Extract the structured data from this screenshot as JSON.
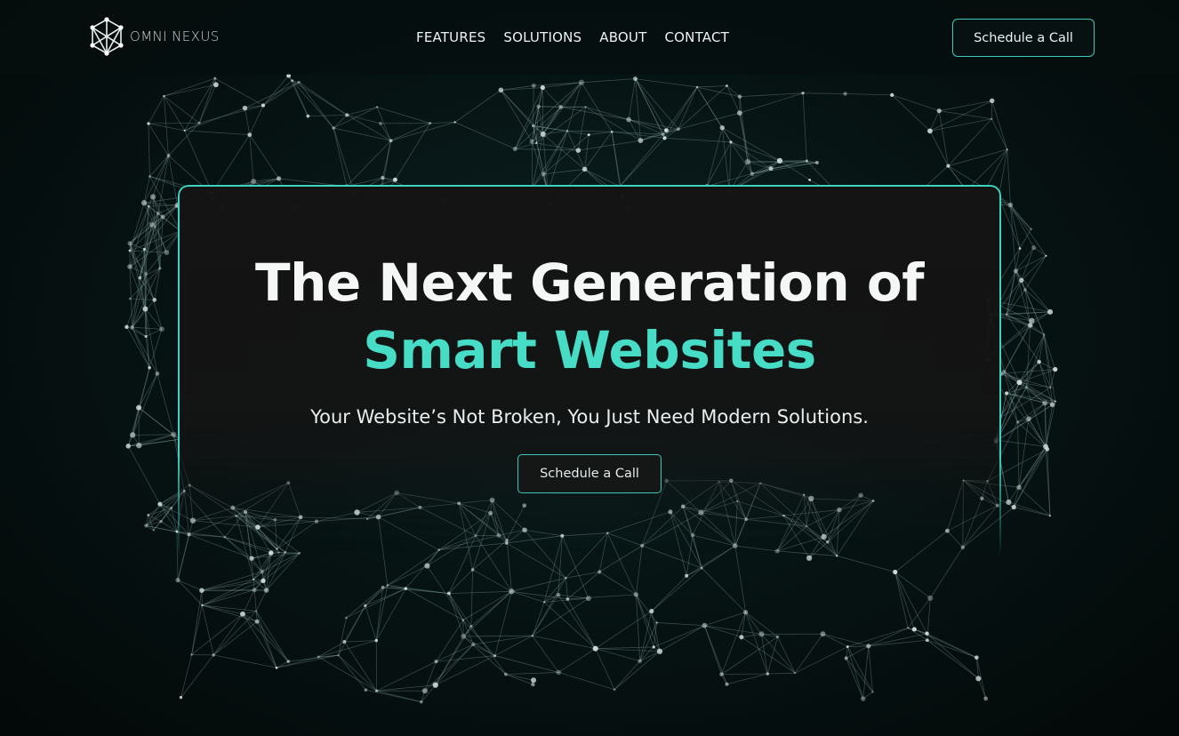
{
  "brand": {
    "logo_icon": "hexagon-network-icon",
    "name": "OMNI NEXUS"
  },
  "nav": {
    "links": [
      "FEATURES",
      "SOLUTIONS",
      "ABOUT",
      "CONTACT"
    ],
    "cta_label": "Schedule a Call"
  },
  "hero": {
    "title_line1": "The Next Generation of",
    "title_line2": "Smart Websites",
    "subtitle": "Your Website’s Not Broken, You Just Need Modern Solutions.",
    "cta_label": "Schedule a Call"
  },
  "colors": {
    "accent": "#46dcc6",
    "border": "#3dd3c0",
    "background": "#061010",
    "card": "#141414"
  }
}
